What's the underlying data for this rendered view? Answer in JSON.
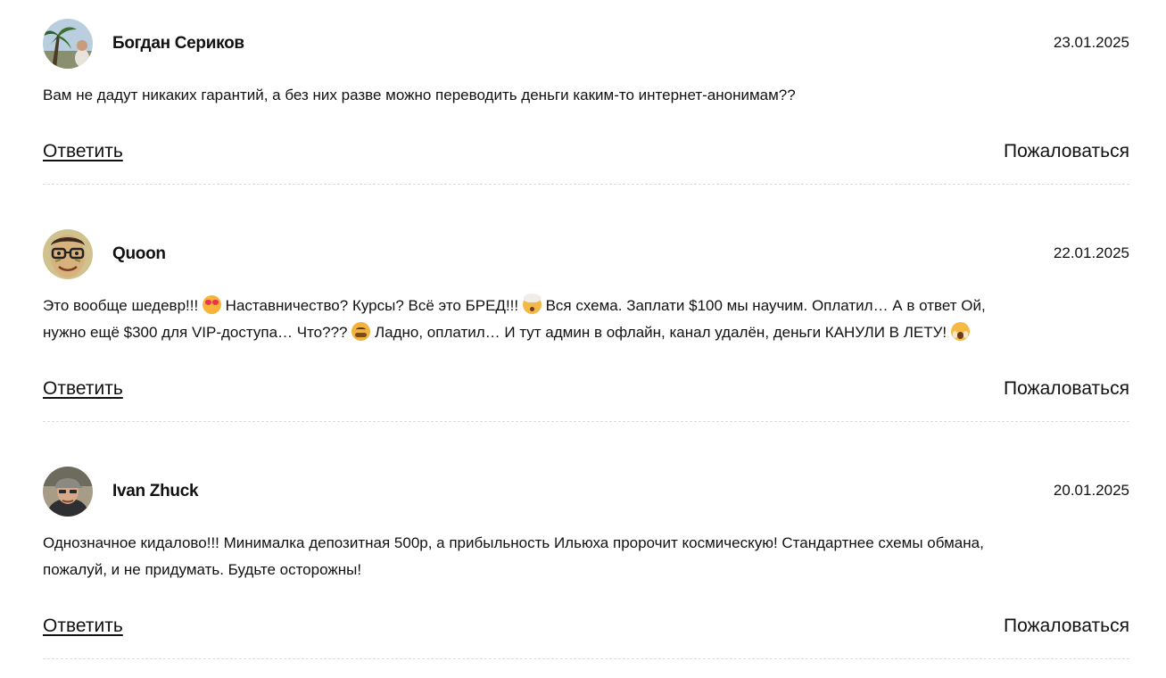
{
  "comments": [
    {
      "author": "Богдан Сериков",
      "date": "23.01.2025",
      "text_lines": [
        "Вам не дадут никаких гарантий, а без них разве можно переводить деньги каким-то интернет-анонимам??"
      ],
      "reply_label": "Ответить",
      "report_label": "Пожаловаться"
    },
    {
      "author": "Quoon",
      "date": "22.01.2025",
      "text_parts": {
        "p1": "Это вообще шедевр!!!",
        "p2": "Наставничество? Курсы? Всё это БРЕД!!!",
        "p3": "Вся схема. Заплати $100 мы научим. Оплатил… А в ответ Ой,",
        "p4": "нужно ещё $300 для VIP-доступа… Что???",
        "p5": "Ладно, оплатил… И тут админ в офлайн, канал удалён, деньги КАНУЛИ В ЛЕТУ!"
      },
      "emojis": [
        "smiling-face-with-heart-eyes",
        "exploding-head",
        "nauseated-face",
        "face-screaming"
      ],
      "reply_label": "Ответить",
      "report_label": "Пожаловаться"
    },
    {
      "author": "Ivan Zhuck",
      "date": "20.01.2025",
      "text_lines": [
        "Однозначное кидалово!!! Минималка депозитная 500р, а прибыльность Ильюха пророчит космическую! Стандартнее схемы обмана,",
        "пожалуй, и не придумать. Будьте осторожны!"
      ],
      "reply_label": "Ответить",
      "report_label": "Пожаловаться"
    }
  ],
  "avatars": [
    "palm-tree-photo-avatar",
    "glasses-man-photo-avatar",
    "man-with-cap-photo-avatar"
  ]
}
